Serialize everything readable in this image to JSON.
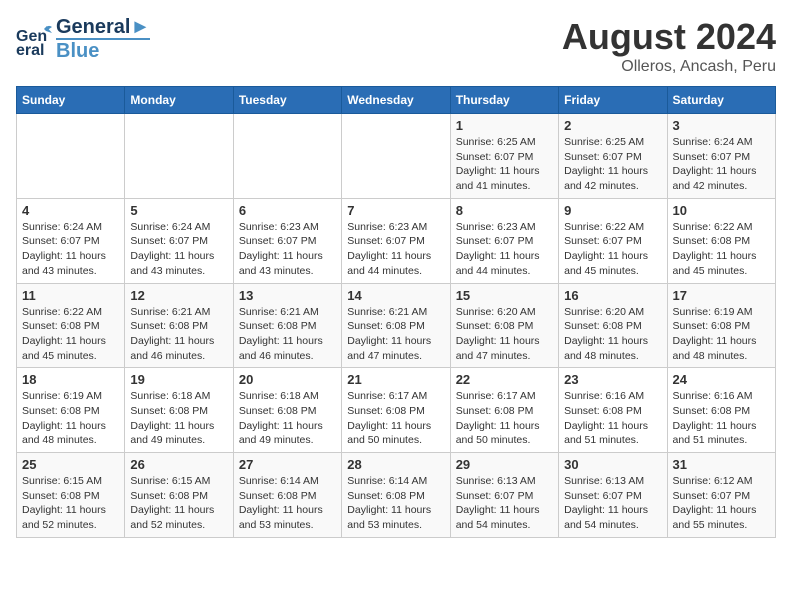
{
  "header": {
    "logo_line1": "General",
    "logo_line2": "Blue",
    "title": "August 2024",
    "subtitle": "Olleros, Ancash, Peru"
  },
  "days_of_week": [
    "Sunday",
    "Monday",
    "Tuesday",
    "Wednesday",
    "Thursday",
    "Friday",
    "Saturday"
  ],
  "weeks": [
    [
      {
        "day": "",
        "info": ""
      },
      {
        "day": "",
        "info": ""
      },
      {
        "day": "",
        "info": ""
      },
      {
        "day": "",
        "info": ""
      },
      {
        "day": "1",
        "info": "Sunrise: 6:25 AM\nSunset: 6:07 PM\nDaylight: 11 hours\nand 41 minutes."
      },
      {
        "day": "2",
        "info": "Sunrise: 6:25 AM\nSunset: 6:07 PM\nDaylight: 11 hours\nand 42 minutes."
      },
      {
        "day": "3",
        "info": "Sunrise: 6:24 AM\nSunset: 6:07 PM\nDaylight: 11 hours\nand 42 minutes."
      }
    ],
    [
      {
        "day": "4",
        "info": "Sunrise: 6:24 AM\nSunset: 6:07 PM\nDaylight: 11 hours\nand 43 minutes."
      },
      {
        "day": "5",
        "info": "Sunrise: 6:24 AM\nSunset: 6:07 PM\nDaylight: 11 hours\nand 43 minutes."
      },
      {
        "day": "6",
        "info": "Sunrise: 6:23 AM\nSunset: 6:07 PM\nDaylight: 11 hours\nand 43 minutes."
      },
      {
        "day": "7",
        "info": "Sunrise: 6:23 AM\nSunset: 6:07 PM\nDaylight: 11 hours\nand 44 minutes."
      },
      {
        "day": "8",
        "info": "Sunrise: 6:23 AM\nSunset: 6:07 PM\nDaylight: 11 hours\nand 44 minutes."
      },
      {
        "day": "9",
        "info": "Sunrise: 6:22 AM\nSunset: 6:07 PM\nDaylight: 11 hours\nand 45 minutes."
      },
      {
        "day": "10",
        "info": "Sunrise: 6:22 AM\nSunset: 6:08 PM\nDaylight: 11 hours\nand 45 minutes."
      }
    ],
    [
      {
        "day": "11",
        "info": "Sunrise: 6:22 AM\nSunset: 6:08 PM\nDaylight: 11 hours\nand 45 minutes."
      },
      {
        "day": "12",
        "info": "Sunrise: 6:21 AM\nSunset: 6:08 PM\nDaylight: 11 hours\nand 46 minutes."
      },
      {
        "day": "13",
        "info": "Sunrise: 6:21 AM\nSunset: 6:08 PM\nDaylight: 11 hours\nand 46 minutes."
      },
      {
        "day": "14",
        "info": "Sunrise: 6:21 AM\nSunset: 6:08 PM\nDaylight: 11 hours\nand 47 minutes."
      },
      {
        "day": "15",
        "info": "Sunrise: 6:20 AM\nSunset: 6:08 PM\nDaylight: 11 hours\nand 47 minutes."
      },
      {
        "day": "16",
        "info": "Sunrise: 6:20 AM\nSunset: 6:08 PM\nDaylight: 11 hours\nand 48 minutes."
      },
      {
        "day": "17",
        "info": "Sunrise: 6:19 AM\nSunset: 6:08 PM\nDaylight: 11 hours\nand 48 minutes."
      }
    ],
    [
      {
        "day": "18",
        "info": "Sunrise: 6:19 AM\nSunset: 6:08 PM\nDaylight: 11 hours\nand 48 minutes."
      },
      {
        "day": "19",
        "info": "Sunrise: 6:18 AM\nSunset: 6:08 PM\nDaylight: 11 hours\nand 49 minutes."
      },
      {
        "day": "20",
        "info": "Sunrise: 6:18 AM\nSunset: 6:08 PM\nDaylight: 11 hours\nand 49 minutes."
      },
      {
        "day": "21",
        "info": "Sunrise: 6:17 AM\nSunset: 6:08 PM\nDaylight: 11 hours\nand 50 minutes."
      },
      {
        "day": "22",
        "info": "Sunrise: 6:17 AM\nSunset: 6:08 PM\nDaylight: 11 hours\nand 50 minutes."
      },
      {
        "day": "23",
        "info": "Sunrise: 6:16 AM\nSunset: 6:08 PM\nDaylight: 11 hours\nand 51 minutes."
      },
      {
        "day": "24",
        "info": "Sunrise: 6:16 AM\nSunset: 6:08 PM\nDaylight: 11 hours\nand 51 minutes."
      }
    ],
    [
      {
        "day": "25",
        "info": "Sunrise: 6:15 AM\nSunset: 6:08 PM\nDaylight: 11 hours\nand 52 minutes."
      },
      {
        "day": "26",
        "info": "Sunrise: 6:15 AM\nSunset: 6:08 PM\nDaylight: 11 hours\nand 52 minutes."
      },
      {
        "day": "27",
        "info": "Sunrise: 6:14 AM\nSunset: 6:08 PM\nDaylight: 11 hours\nand 53 minutes."
      },
      {
        "day": "28",
        "info": "Sunrise: 6:14 AM\nSunset: 6:08 PM\nDaylight: 11 hours\nand 53 minutes."
      },
      {
        "day": "29",
        "info": "Sunrise: 6:13 AM\nSunset: 6:07 PM\nDaylight: 11 hours\nand 54 minutes."
      },
      {
        "day": "30",
        "info": "Sunrise: 6:13 AM\nSunset: 6:07 PM\nDaylight: 11 hours\nand 54 minutes."
      },
      {
        "day": "31",
        "info": "Sunrise: 6:12 AM\nSunset: 6:07 PM\nDaylight: 11 hours\nand 55 minutes."
      }
    ]
  ]
}
